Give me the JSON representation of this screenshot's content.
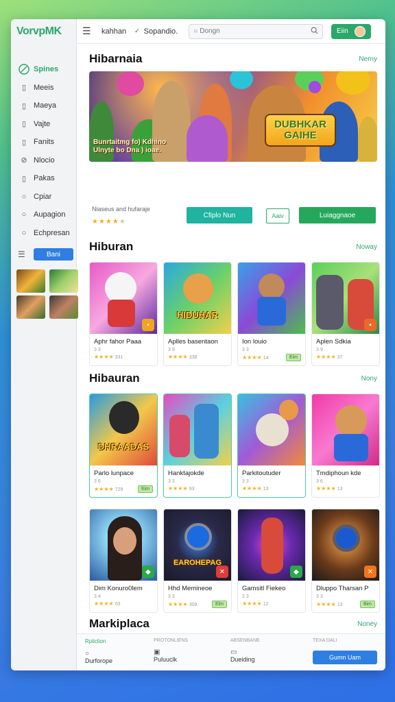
{
  "app": {
    "logo": "VorvpMK"
  },
  "sidebar": {
    "items": [
      {
        "label": "Spines",
        "icon": "leaf-icon",
        "active": true
      },
      {
        "label": "Meeis",
        "icon": "square-icon"
      },
      {
        "label": "Maeya",
        "icon": "square-icon"
      },
      {
        "label": "Vajte",
        "icon": "square-icon"
      },
      {
        "label": "Fanits",
        "icon": "square-icon"
      },
      {
        "label": "Nlocio",
        "icon": "link-icon"
      },
      {
        "label": "Pakas",
        "icon": "square-icon"
      },
      {
        "label": "Cpiar",
        "icon": "circle-icon"
      },
      {
        "label": "Aupagion",
        "icon": "circle-icon"
      },
      {
        "label": "Echpresan",
        "icon": "circle-icon"
      }
    ],
    "button_label": "Bani"
  },
  "topbar": {
    "text1": "kahhan",
    "text2": "Sopandio.",
    "search_placeholder": "Dongn",
    "button_label": "Eiin"
  },
  "sections": {
    "featured": {
      "title": "Hibarnaia",
      "more": "Nerny"
    },
    "hiburan": {
      "title": "Hiburan",
      "more": "Noway"
    },
    "hibauran": {
      "title": "Hibauran",
      "more": "Nony"
    },
    "marketplace": {
      "title": "Markiplaca",
      "more": "Noney"
    }
  },
  "hero": {
    "overlay_line1": "Bunrtaitmg fo) Kdhino",
    "overlay_line2": "Ulnyte bo Dna ) ioae.",
    "logo_line1": "DUBHKAR",
    "logo_line2": "GAIHE",
    "subtitle": "Niaseus and hufaraje",
    "stars": 4,
    "btn_primary": "Cfiplo Nun",
    "btn_outline": "Aaiv",
    "btn_secondary": "Luiaggnaoe"
  },
  "row1": [
    {
      "title": "Aphr fahor Paaa",
      "sub": "3 3",
      "rating": "★★★★",
      "count": "331",
      "button": "",
      "thumb_text": "",
      "badge": "orange"
    },
    {
      "title": "Aplles basentaon",
      "sub": "3 9",
      "rating": "★★★★",
      "count": "338",
      "button": "",
      "thumb_text": "HIDUHAR",
      "badge": ""
    },
    {
      "title": "Ion louio",
      "sub": "3 3",
      "rating": "★★★★",
      "count": "14",
      "button": "Eim",
      "thumb_text": "",
      "badge": ""
    },
    {
      "title": "Aplen Sdkia",
      "sub": "3 9",
      "rating": "★★★★",
      "count": "37",
      "button": "",
      "thumb_text": "",
      "badge": "orange"
    }
  ],
  "row2": [
    {
      "title": "Parlo lunpace",
      "sub": "3 6",
      "rating": "★★★★",
      "count": "729",
      "button": "Eim",
      "thumb_text": "DHRAADAS",
      "badge": ""
    },
    {
      "title": "Hanktajokde",
      "sub": "3 3",
      "rating": "★★★★",
      "count": "93",
      "button": "",
      "thumb_text": "",
      "badge": ""
    },
    {
      "title": "Parkitoutuder",
      "sub": "3 3",
      "rating": "★★★★",
      "count": "13",
      "button": "",
      "thumb_text": "",
      "badge": ""
    },
    {
      "title": "Tmdiphoun kde",
      "sub": "3 6",
      "rating": "★★★★",
      "count": "13",
      "button": "",
      "thumb_text": "",
      "badge": ""
    }
  ],
  "row3": [
    {
      "title": "Dim Konuro0lem",
      "sub": "3 4",
      "rating": "★★★★",
      "count": "03",
      "button": "",
      "thumb_text": "",
      "badge": "green"
    },
    {
      "title": "Hhd Memineoe",
      "sub": "3 3",
      "rating": "★★★★",
      "count": "309",
      "button": "Elm",
      "thumb_text": "EAROHEPAG",
      "badge": "red"
    },
    {
      "title": "Gamsitl Fiekeo",
      "sub": "3 3",
      "rating": "★★★★",
      "count": "12",
      "button": "",
      "thumb_text": "",
      "badge": "green"
    },
    {
      "title": "Dluppo Tharsan P",
      "sub": "3 3",
      "rating": "★★★★",
      "count": "13",
      "button": "Bim",
      "thumb_text": "",
      "badge": "orange"
    }
  ],
  "bottombar": {
    "col1_label": "Rpliclion",
    "col1_item": "Durforope",
    "col2_label": "PROTONLIENS",
    "col2_item": "Puluuclk",
    "col3_label": "ABSENBANE",
    "col3_item": "Dueiding",
    "col4_label": "TEXA DALI",
    "button_label": "Gumn Uam"
  },
  "colors": {
    "accent_green": "#2aa86a",
    "accent_blue": "#2f7fe0",
    "teal": "#1fb3a0"
  }
}
